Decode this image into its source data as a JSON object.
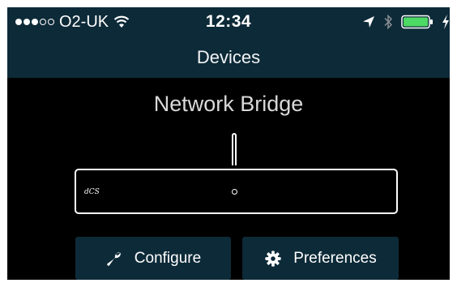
{
  "status_bar": {
    "carrier": "O2-UK",
    "signal_bars_filled": 3,
    "signal_bars_total": 5,
    "time": "12:34",
    "icons": [
      "wifi-icon",
      "location-arrow-icon",
      "bluetooth-icon",
      "battery-icon",
      "charging-icon"
    ],
    "battery_level": 1.0,
    "battery_color": "#4cd964"
  },
  "nav": {
    "title": "Devices"
  },
  "device": {
    "name": "Network Bridge",
    "logo": "dCS"
  },
  "actions": {
    "configure": {
      "label": "Configure",
      "icon": "wrench-icon"
    },
    "preferences": {
      "label": "Preferences",
      "icon": "gear-icon"
    }
  },
  "colors": {
    "bar_background": "#0d2a38",
    "screen_background": "#000000",
    "button_background": "#0d2a38",
    "text": "#ffffff"
  }
}
